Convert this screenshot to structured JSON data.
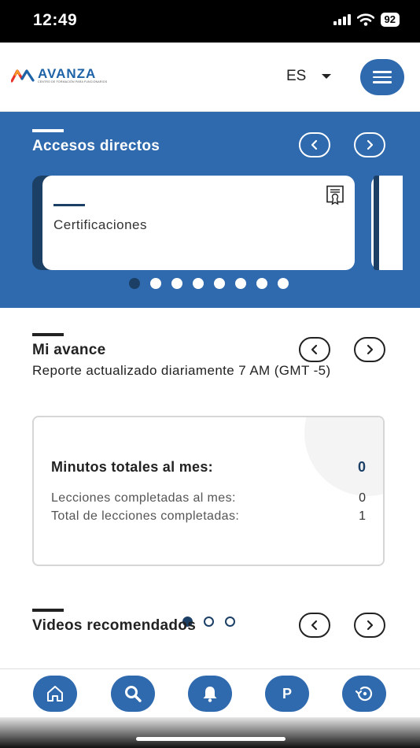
{
  "status_bar": {
    "time": "12:49",
    "battery": "92"
  },
  "header": {
    "logo_text": "AVANZA",
    "logo_subtext": "CENTRO DE FORMACIÓN PARA FUNCIONARIOS",
    "language": "ES"
  },
  "shortcuts": {
    "title": "Accesos directos",
    "card_label": "Certificaciones",
    "page_count": 8,
    "active_page": 1
  },
  "progress": {
    "title": "Mi avance",
    "subtitle": "Reporte actualizado diariamente 7 AM (GMT -5)",
    "stats": {
      "main_label": "Minutos totales al mes:",
      "main_value": "0",
      "row1_label": "Lecciones completadas al mes:",
      "row1_value": "0",
      "row2_label": "Total de lecciones completadas:",
      "row2_value": "1"
    },
    "page_count": 3,
    "active_page": 1
  },
  "videos": {
    "title": "Videos recomendados"
  },
  "bottom_nav": {
    "profile_label": "P"
  },
  "colors": {
    "primary": "#2f6aae",
    "dark_navy": "#1c3f66",
    "white": "#ffffff"
  },
  "icons": [
    "wifi-icon",
    "menu-icon",
    "chevron-left-icon",
    "chevron-right-icon",
    "certificate-icon",
    "home-icon",
    "search-icon",
    "bell-icon",
    "history-icon"
  ]
}
